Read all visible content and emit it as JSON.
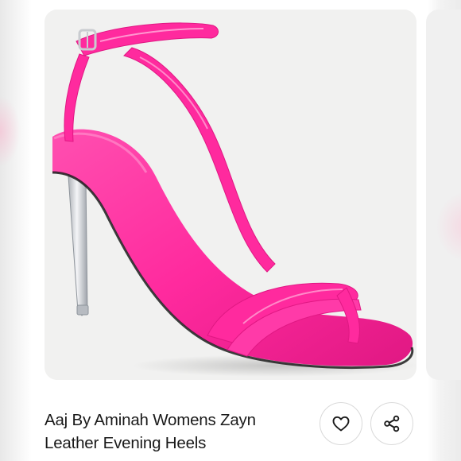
{
  "product": {
    "title_line1": "Aaj By Aminah Womens Zayn",
    "title_line2": "Leather Evening Heels",
    "image": {
      "subject": "pink-patent-strappy-sandal-icon",
      "strap_color": "#ff2a9e",
      "heel_color": "#c9ccd0",
      "background": "#f1f1f0"
    }
  },
  "actions": {
    "like_icon": "heart-outline-icon",
    "share_icon": "share-nodes-icon"
  }
}
